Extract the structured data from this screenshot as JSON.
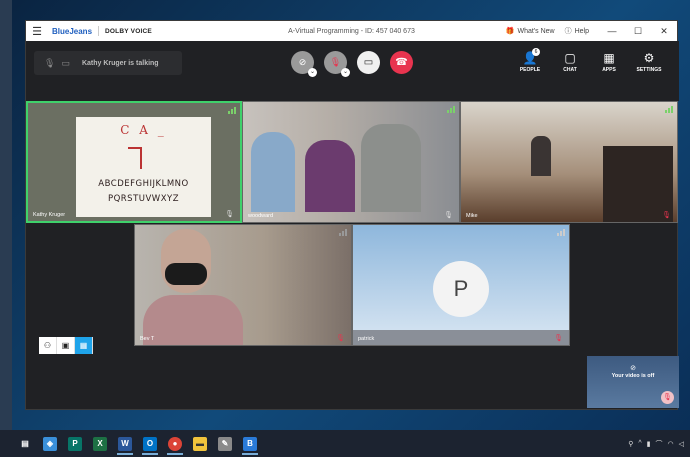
{
  "window": {
    "brand": "BlueJeans",
    "partner": "DOLBY VOICE",
    "title": "A-Virtual Programming - ID: 457 040 673",
    "whats_new": "What's New",
    "help": "Help"
  },
  "toolbar": {
    "talking_status": "Kathy Kruger is talking",
    "people_label": "PEOPLE",
    "people_count": "6",
    "chat_label": "CHAT",
    "apps_label": "APPS",
    "settings_label": "SETTINGS"
  },
  "tiles": [
    {
      "name": "Kathy Kruger",
      "mic": "on",
      "active_speaker": true
    },
    {
      "name": "woodward",
      "mic": "on"
    },
    {
      "name": "Mike",
      "mic": "muted"
    },
    {
      "name": "Bev T",
      "mic": "muted"
    },
    {
      "name": "patrick",
      "mic": "muted",
      "avatar_letter": "P"
    }
  ],
  "whiteboard": {
    "top": "C A _",
    "line1": "ABCDEFGHIJKLMNO",
    "line2": "PQRSTUVWXYZ"
  },
  "self_view": {
    "status": "Your video is off"
  },
  "layout_switch": {
    "options": [
      "people-view",
      "speaker-view",
      "gallery-view"
    ],
    "active": "gallery-view"
  },
  "colors": {
    "active_border": "#3fd16b",
    "end_call": "#e8344f",
    "accent": "#1fa4ea"
  },
  "taskbar": {
    "apps": [
      "task-view",
      "maps",
      "publisher",
      "excel",
      "word",
      "outlook",
      "chrome",
      "file-explorer",
      "paint",
      "bluejeans"
    ]
  }
}
